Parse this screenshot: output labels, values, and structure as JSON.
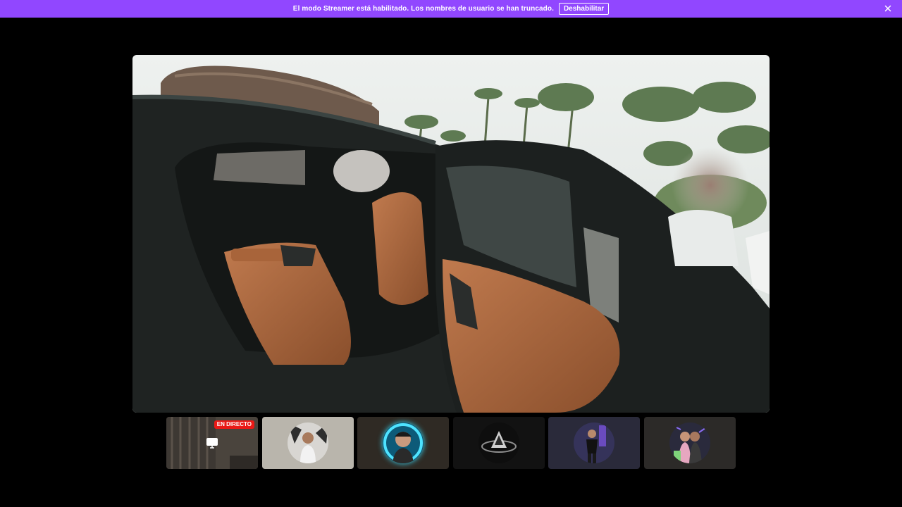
{
  "banner": {
    "message": "El modo Streamer está habilitado. Los nombres de usuario se han truncado.",
    "disable_label": "Deshabilitar",
    "close_icon": "close-icon",
    "color": "#9147ff"
  },
  "player": {
    "scene": "car-interior-video"
  },
  "channels": [
    {
      "id": "channel-1",
      "live_label": "EN DIRECTO",
      "icon": "screen-icon",
      "bg": "#2a2622"
    },
    {
      "id": "channel-2",
      "bg": "#b9b5ac"
    },
    {
      "id": "channel-3",
      "bg": "#2f2a24"
    },
    {
      "id": "channel-4",
      "bg": "#121212"
    },
    {
      "id": "channel-5",
      "bg": "#2a2a3a"
    },
    {
      "id": "channel-6",
      "bg": "#2c2a28"
    }
  ]
}
